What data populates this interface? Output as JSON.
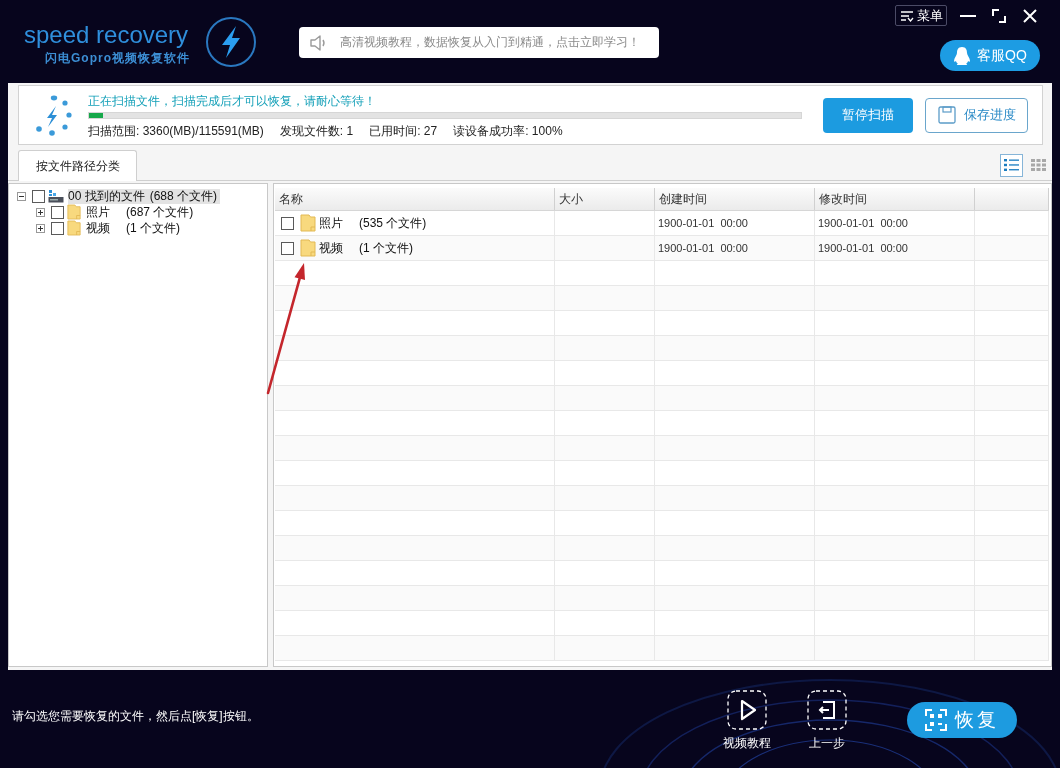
{
  "header": {
    "logo_title": "speed recovery",
    "logo_subtitle": "闪电Gopro视频恢复软件",
    "notice": "高清视频教程，数据恢复从入门到精通，点击立即学习！",
    "menu_button": "菜单",
    "support_button": "客服QQ"
  },
  "scan": {
    "status": "正在扫描文件，扫描完成后才可以恢复，请耐心等待！",
    "level": 0.02,
    "stats": [
      "扫描范围: 3360(MB)/115591(MB)",
      "发现文件数: 1",
      "已用时间: 27",
      "读设备成功率: 100%"
    ],
    "buttons": [
      {
        "kind": "pause",
        "label": "暂停扫描"
      },
      {
        "kind": "save",
        "label": "保存进度"
      }
    ]
  },
  "tabs": [
    {
      "label": "按文件路径分类",
      "selected": true
    }
  ],
  "view_modes": [
    {
      "kind": "list",
      "selected": true
    },
    {
      "kind": "grid",
      "selected": false
    }
  ],
  "tree": [
    {
      "kind": "drive",
      "label": "00 找到的文件",
      "count": "(688 个文件)",
      "checked": false,
      "expanded": true,
      "selected": true,
      "children": [
        {
          "kind": "folder",
          "label": "照片",
          "count": "(687 个文件)",
          "checked": false,
          "expanded": false,
          "selected": false
        },
        {
          "kind": "folder",
          "label": "视频",
          "count": "(1 个文件)",
          "checked": false,
          "expanded": false,
          "selected": false
        }
      ]
    }
  ],
  "table": {
    "columns": [
      "名称",
      "大小",
      "创建时间",
      "修改时间"
    ],
    "rows": [
      {
        "checked": false,
        "name": "照片",
        "count": "(535 个文件)",
        "created": "1900-01-01  00:00",
        "modified": "1900-01-01  00:00"
      },
      {
        "checked": false,
        "name": "视频",
        "count": "(1 个文件)",
        "created": "1900-01-01  00:00",
        "modified": "1900-01-01  00:00"
      }
    ]
  },
  "footer": {
    "hint": "请勾选您需要恢复的文件，然后点[恢复]按钮。",
    "actions": [
      {
        "kind": "play",
        "label": "视频教程"
      },
      {
        "kind": "back",
        "label": "上一步"
      }
    ],
    "recover_button": "恢复"
  }
}
